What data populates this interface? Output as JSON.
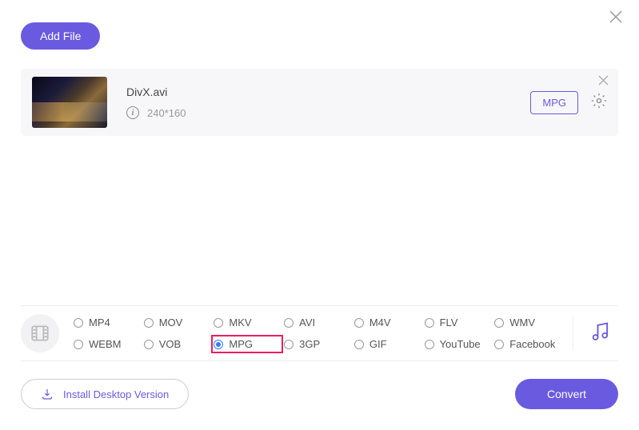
{
  "header": {
    "add_file_label": "Add File"
  },
  "file": {
    "name": "DivX.avi",
    "resolution": "240*160",
    "selected_format": "MPG"
  },
  "formats": {
    "row1": [
      "MP4",
      "MOV",
      "MKV",
      "AVI",
      "M4V",
      "FLV",
      "WMV"
    ],
    "row2": [
      "WEBM",
      "VOB",
      "MPG",
      "3GP",
      "GIF",
      "YouTube",
      "Facebook"
    ],
    "selected": "MPG"
  },
  "footer": {
    "install_label": "Install Desktop Version",
    "convert_label": "Convert"
  }
}
